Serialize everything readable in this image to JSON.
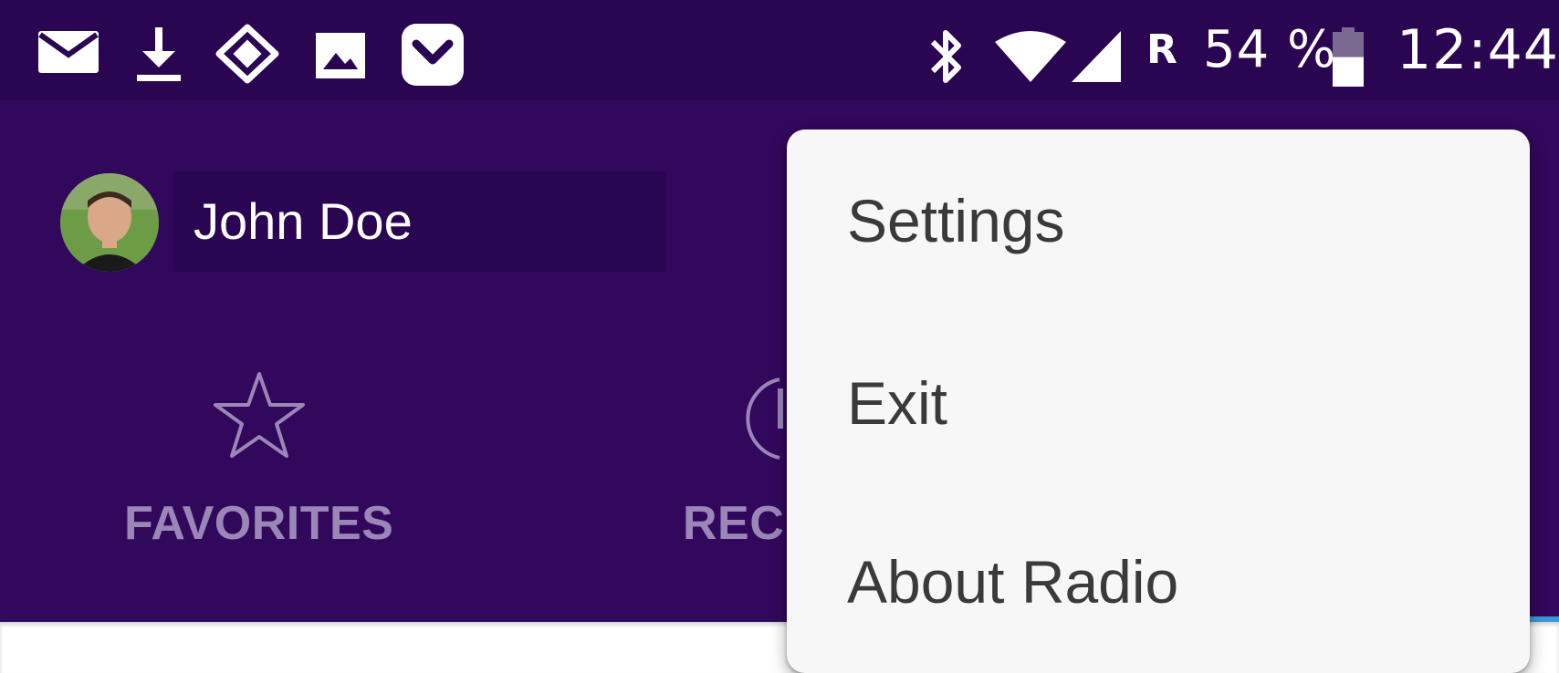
{
  "status_bar": {
    "icons": [
      "mail-icon",
      "download-icon",
      "tag-icon",
      "image-icon",
      "pocket-icon"
    ],
    "system_icons": [
      "bluetooth-icon",
      "wifi-icon",
      "signal-icon",
      "battery-icon"
    ],
    "roaming": "R",
    "battery": "54 %",
    "battery_level": 0.54,
    "time": "12:44",
    "background": "#2a0552"
  },
  "header": {
    "user_name": "John Doe",
    "background": "#32085c"
  },
  "tabs": [
    {
      "label": "FAVORITES",
      "icon": "star-icon"
    },
    {
      "label": "RECI",
      "icon": "recent-icon"
    }
  ],
  "overflow_menu": {
    "items": [
      {
        "label": "Settings"
      },
      {
        "label": "Exit"
      },
      {
        "label": "About Radio"
      }
    ]
  }
}
